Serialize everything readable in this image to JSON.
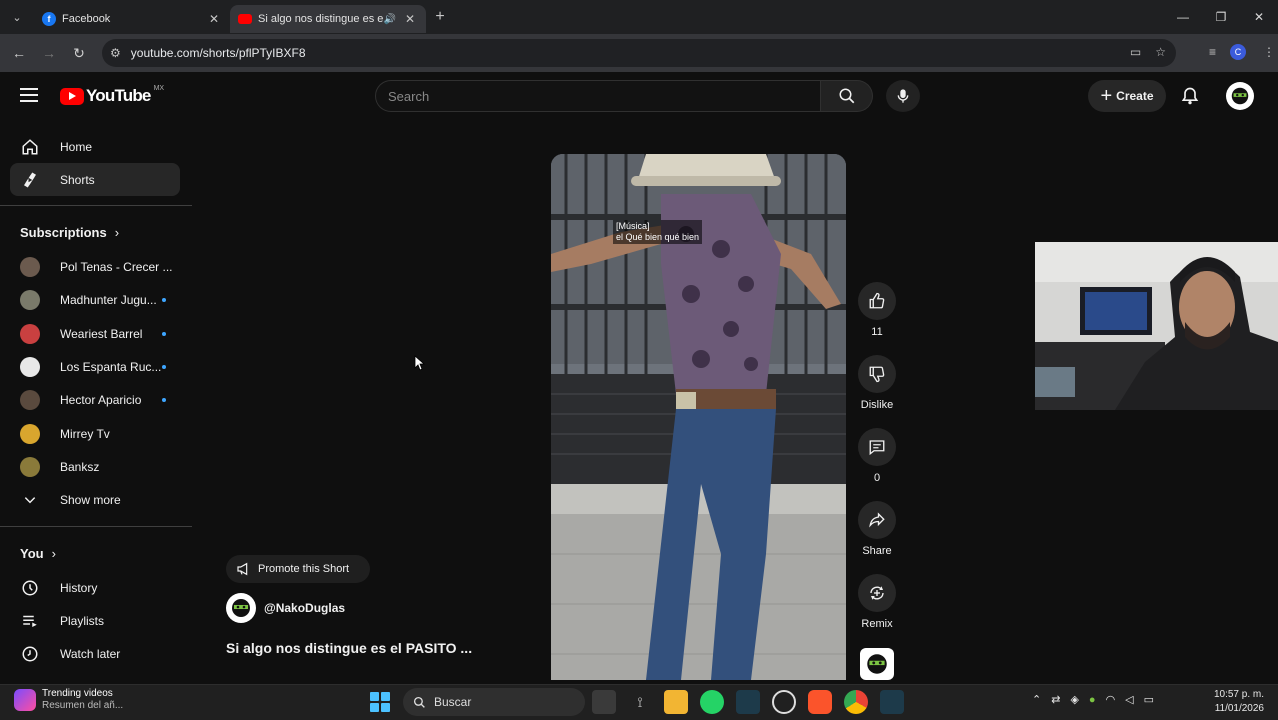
{
  "browser": {
    "tabs": [
      {
        "title": "Facebook",
        "active": false,
        "favicon": "facebook-icon"
      },
      {
        "title": "Si algo nos distingue es el P",
        "active": true,
        "favicon": "youtube-icon"
      }
    ],
    "url": "youtube.com/shorts/pflPTyIBXF8",
    "profile_initial": "C"
  },
  "youtube": {
    "logo_text": "YouTube",
    "country_code": "MX",
    "search_placeholder": "Search",
    "create_label": "Create"
  },
  "sidebar": {
    "main": [
      {
        "label": "Home",
        "icon": "home-icon",
        "active": false
      },
      {
        "label": "Shorts",
        "icon": "shorts-icon",
        "active": true
      }
    ],
    "subscriptions_header": "Subscriptions",
    "subscriptions": [
      {
        "label": "Pol Tenas - Crecer ...",
        "new": false,
        "color": "#6b5a4e"
      },
      {
        "label": "Madhunter Jugu...",
        "new": true,
        "color": "#7a7a6a"
      },
      {
        "label": "Weariest Barrel",
        "new": true,
        "color": "#c94040"
      },
      {
        "label": "Los Espanta Ruc...",
        "new": true,
        "color": "#e8e8e8"
      },
      {
        "label": "Hector Aparicio",
        "new": true,
        "color": "#5a4a3e"
      },
      {
        "label": "Mirrey Tv",
        "new": false,
        "color": "#d9a62e"
      },
      {
        "label": "Banksz",
        "new": false,
        "color": "#8a7a3a"
      }
    ],
    "show_more": "Show more",
    "you_header": "You",
    "you_items": [
      {
        "label": "History",
        "icon": "history-icon"
      },
      {
        "label": "Playlists",
        "icon": "playlists-icon"
      },
      {
        "label": "Watch later",
        "icon": "watch-later-icon"
      }
    ]
  },
  "short": {
    "caption_line1": "[Música]",
    "caption_line2": "el Qué bien qué bien",
    "likes": "11",
    "dislike_label": "Dislike",
    "comments": "0",
    "share_label": "Share",
    "remix_label": "Remix",
    "promote_label": "Promote this Short",
    "channel": "@NakoDuglas",
    "title": "Si algo nos distingue es el PASITO ..."
  },
  "taskbar": {
    "widget_title": "Trending videos",
    "widget_subtitle": "Resumen del añ...",
    "search_label": "Buscar",
    "time": "10:57 p. m.",
    "date": "11/01/2026"
  }
}
